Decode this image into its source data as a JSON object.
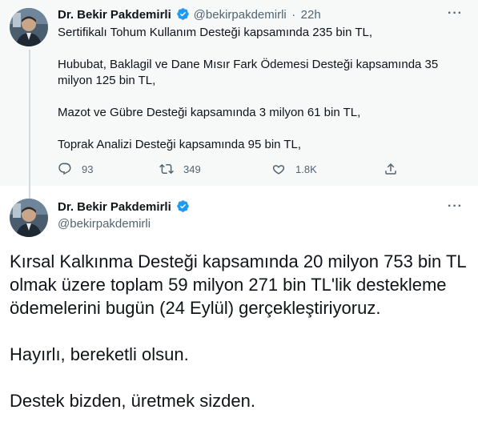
{
  "tweet1": {
    "author_name": "Dr. Bekir Pakdemirli",
    "handle": "@bekirpakdemirli",
    "separator": "·",
    "time": "22h",
    "paragraphs": [
      "Sertifikalı Tohum Kullanım Desteği kapsamında 235 bin TL,",
      "Hububat, Baklagil ve Dane Mısır Fark Ödemesi Desteği kapsamında 35 milyon 125 bin TL,",
      "Mazot ve Gübre Desteği kapsamında 3 milyon 61 bin TL,",
      "Toprak Analizi Desteği kapsamında 95 bin TL,"
    ],
    "reply_count": "93",
    "retweet_count": "349",
    "like_count": "1.8K"
  },
  "tweet2": {
    "author_name": "Dr. Bekir Pakdemirli",
    "handle": "@bekirpakdemirli",
    "paragraphs": [
      "Kırsal Kalkınma Desteği kapsamında 20 milyon 753 bin TL olmak üzere toplam 59 milyon 271 bin TL'lik destekleme ödemelerini bugün (24 Eylül) gerçekleştiriyoruz.",
      "Hayırlı, bereketli olsun.",
      "Destek bizden, üretmek sizden."
    ]
  },
  "icons": {
    "more": "more-icon",
    "verified": "verified-badge-icon",
    "reply": "reply-icon",
    "retweet": "retweet-icon",
    "like": "heart-icon",
    "share": "share-icon"
  },
  "colors": {
    "verified_blue": "#1d9bf0",
    "secondary_text": "#536471",
    "thread_background": "#f7f9f9",
    "thread_line": "#cfd9de"
  }
}
